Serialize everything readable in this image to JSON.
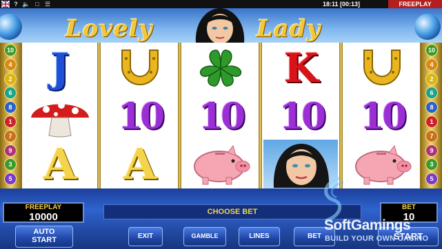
{
  "system_bar": {
    "flag_label": "UK flag",
    "help_label": "?",
    "sound_icon": "speaker-icon",
    "fullscreen_icon": "window-icon",
    "menu_icon": "menu-icon",
    "time": "18:11 [00:13]",
    "mode": "FREEPLAY"
  },
  "header": {
    "title_left": "Lovely",
    "title_right": "Lady"
  },
  "reels": {
    "grid": [
      [
        "J",
        "mushroom",
        "A"
      ],
      [
        "horseshoe",
        "10",
        "A"
      ],
      [
        "clover",
        "10",
        "pig"
      ],
      [
        "K",
        "10",
        "lady"
      ],
      [
        "horseshoe",
        "10",
        "pig"
      ]
    ]
  },
  "paylines": {
    "left": [
      "10",
      "4",
      "2",
      "6",
      "8",
      "1",
      "7",
      "9",
      "3",
      "5"
    ],
    "right": [
      "10",
      "4",
      "2",
      "6",
      "8",
      "1",
      "7",
      "9",
      "3",
      "5"
    ],
    "colors": [
      "#3a9b2a",
      "#d98a12",
      "#d9b412",
      "#1aa58a",
      "#2a62c9",
      "#c9242a",
      "#c9701a",
      "#b0327a",
      "#3a9b2a",
      "#7a3ac9"
    ]
  },
  "panel": {
    "credit_label": "FREEPLAY",
    "credit_value": "10000",
    "message": "CHOOSE BET",
    "bet_label": "BET",
    "bet_value": "10",
    "buttons": {
      "auto_start": "AUTO\nSTART",
      "exit": "EXIT",
      "gamble": "GAMBLE",
      "lines": "LINES",
      "bet": "BET",
      "start": "START"
    }
  },
  "watermark": {
    "brand": "SoftGamings",
    "tagline": "BUILD YOUR OWN CASINO"
  }
}
